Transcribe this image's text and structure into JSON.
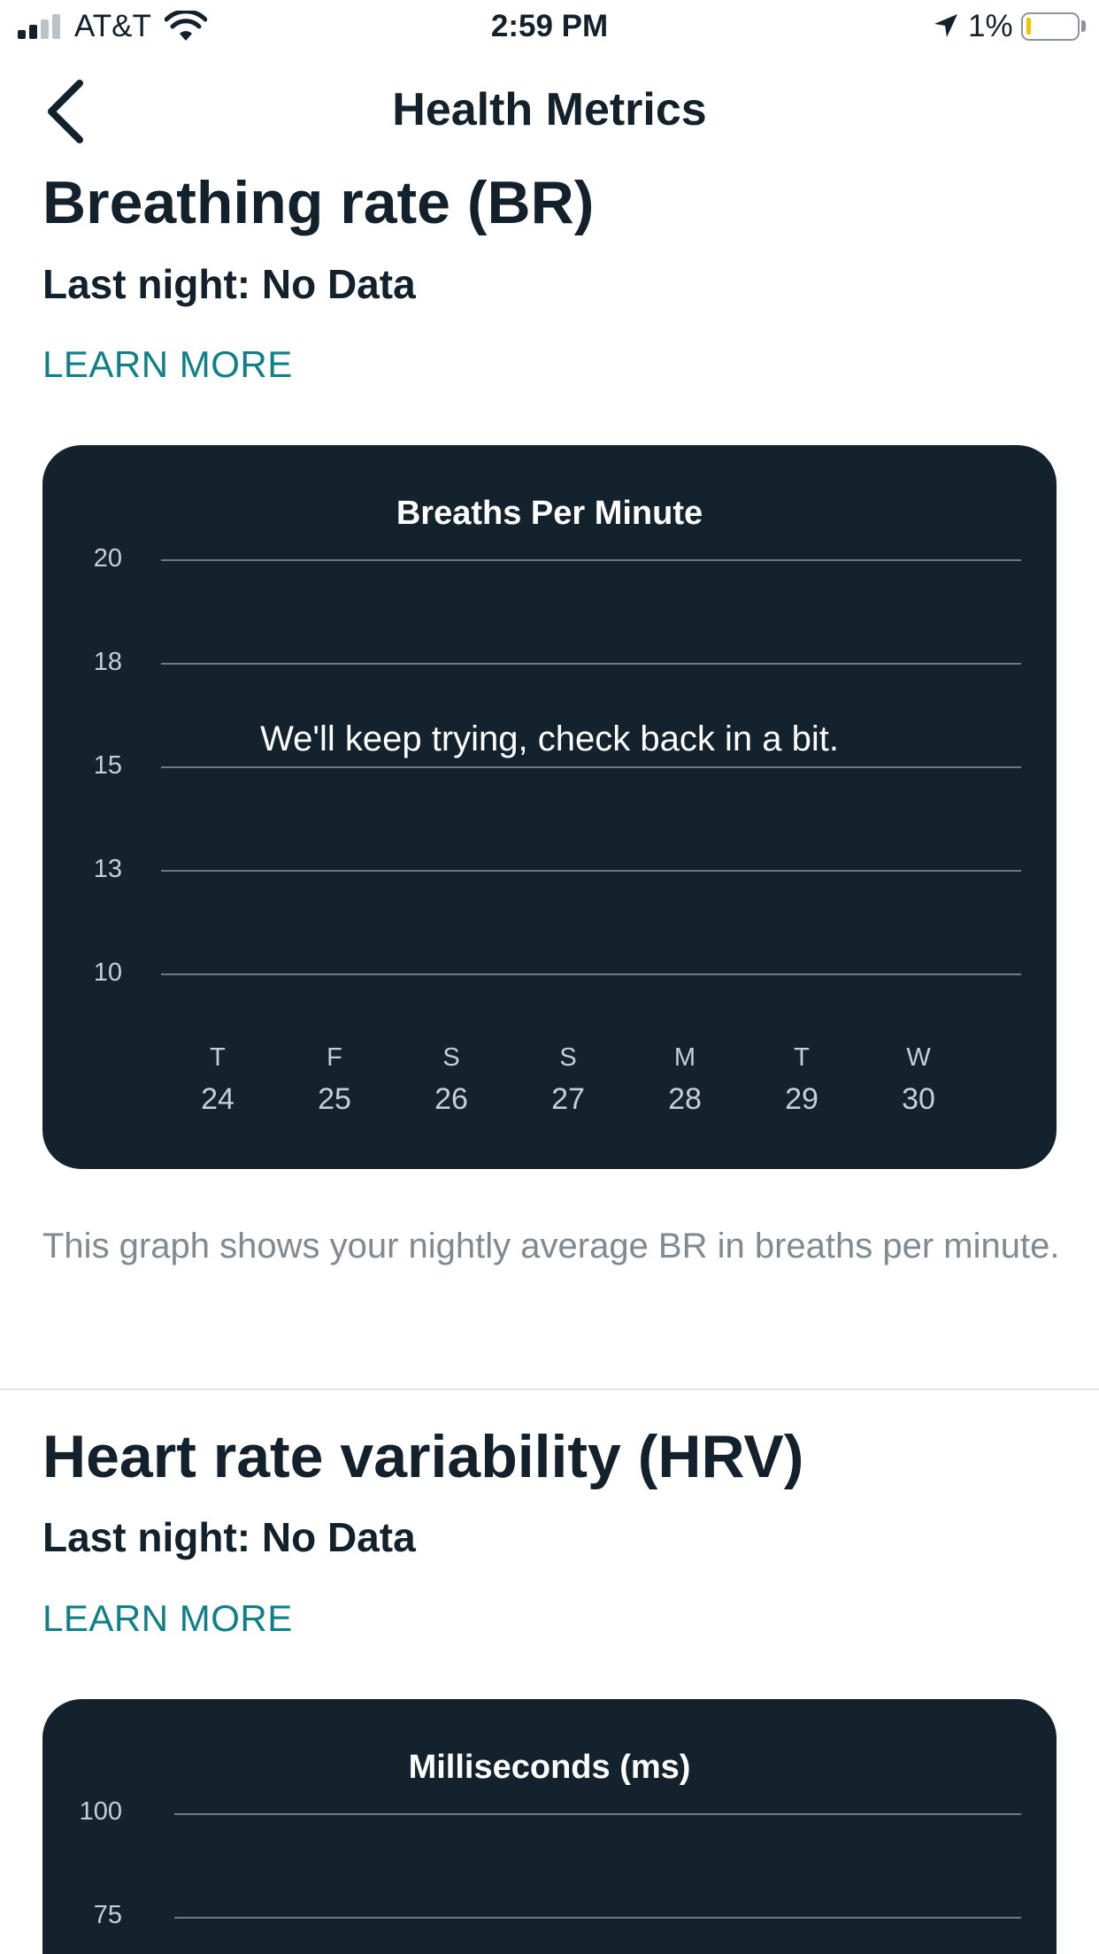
{
  "status_bar": {
    "carrier": "AT&T",
    "time": "2:59 PM",
    "battery_percent": "1%",
    "signal_bars_active": 2,
    "signal_bars_total": 4,
    "battery_level": 0.01,
    "icons": [
      "signal-icon",
      "wifi-icon",
      "location-arrow-icon",
      "battery-icon"
    ]
  },
  "nav": {
    "title": "Health Metrics",
    "back_icon": "chevron-left-icon"
  },
  "colors": {
    "card_background": "#13222d",
    "link": "#0f7f88",
    "text_primary": "#12212b",
    "text_secondary": "#7f8a92",
    "battery_low": "#f2c400"
  },
  "br": {
    "title": "Breathing rate (BR)",
    "last_night": "Last night: No Data",
    "learn_more": "LEARN MORE",
    "chart": {
      "title": "Breaths Per Minute",
      "y_ticks": [
        "20",
        "18",
        "15",
        "13",
        "10"
      ],
      "message": "We'll keep trying, check back in a bit.",
      "days": [
        "T",
        "F",
        "S",
        "S",
        "M",
        "T",
        "W"
      ],
      "dates": [
        "24",
        "25",
        "26",
        "27",
        "28",
        "29",
        "30"
      ]
    },
    "caption": "This graph shows your nightly average BR in breaths per minute."
  },
  "hrv": {
    "title": "Heart rate variability (HRV)",
    "last_night": "Last night: No Data",
    "learn_more": "LEARN MORE",
    "chart": {
      "title": "Milliseconds (ms)",
      "y_ticks": [
        "100",
        "75"
      ]
    }
  },
  "chart_data": [
    {
      "type": "line",
      "title": "Breaths Per Minute",
      "xlabel": "",
      "ylabel": "",
      "categories": [
        "T 24",
        "F 25",
        "S 26",
        "S 27",
        "M 28",
        "T 29",
        "W 30"
      ],
      "series": [],
      "ylim": [
        10,
        20
      ],
      "y_ticks": [
        20,
        18,
        15,
        13,
        10
      ],
      "grid": true,
      "annotation": "We'll keep trying, check back in a bit."
    },
    {
      "type": "line",
      "title": "Milliseconds (ms)",
      "xlabel": "",
      "ylabel": "",
      "series": [],
      "y_ticks": [
        100,
        75
      ],
      "grid": true
    }
  ]
}
